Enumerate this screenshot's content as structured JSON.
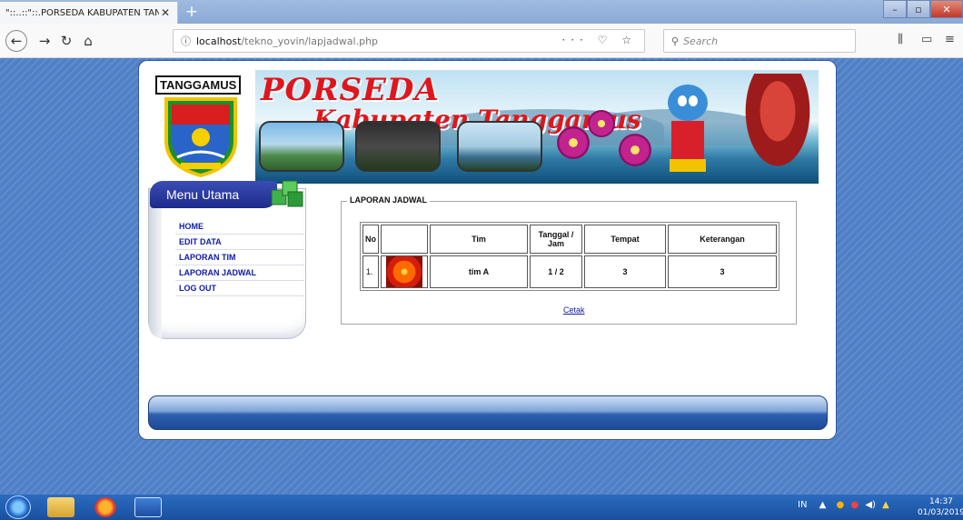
{
  "browser": {
    "tab_title": "\"::..::\"::.PORSEDA KABUPATEN TAN",
    "tab_close": "✕",
    "new_tab": "+",
    "url_host": "localhost",
    "url_path": "/tekno_yovin/lapjadwal.php",
    "search_placeholder": "Search",
    "url_actions": "··· ♡ ☆"
  },
  "banner": {
    "region_label": "TANGGAMUS",
    "title_line1": "PORSEDA",
    "title_line2": "Kabupaten Tanggamus"
  },
  "menu": {
    "header": "Menu Utama",
    "items": [
      {
        "label": "HOME"
      },
      {
        "label": "EDIT DATA"
      },
      {
        "label": "LAPORAN TIM"
      },
      {
        "label": "LAPORAN JADWAL"
      },
      {
        "label": "LOG OUT"
      }
    ]
  },
  "report": {
    "legend": "LAPORAN JADWAL",
    "columns": [
      "No",
      "",
      "Tim",
      "Tanggal / Jam",
      "Tempat",
      "Keterangan"
    ],
    "rows": [
      {
        "no": "1.",
        "tim": "tim A",
        "tanggal_jam": "1 / 2",
        "tempat": "3",
        "keterangan": "3"
      }
    ],
    "print_link": "Cetak"
  },
  "taskbar": {
    "lang": "IN",
    "time": "14:37",
    "date": "01/03/2019"
  }
}
